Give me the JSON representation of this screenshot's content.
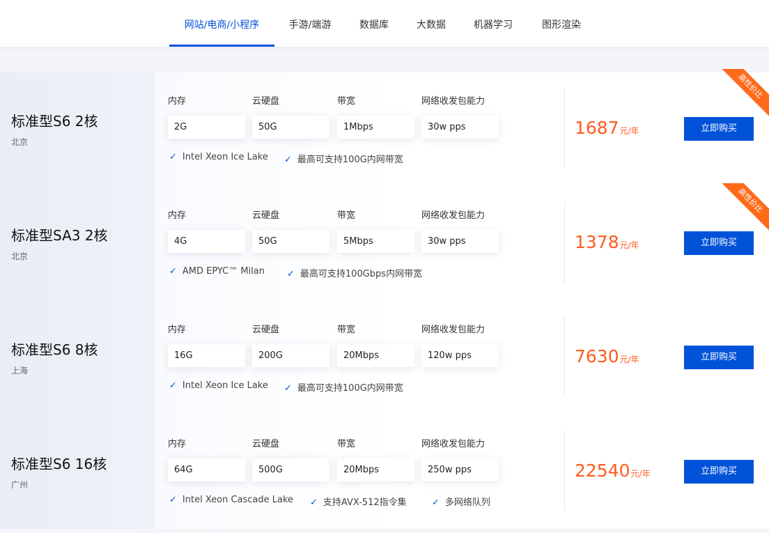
{
  "tabs": [
    {
      "label": "网站/电商/小程序",
      "active": true
    },
    {
      "label": "手游/端游",
      "active": false
    },
    {
      "label": "数据库",
      "active": false
    },
    {
      "label": "大数据",
      "active": false
    },
    {
      "label": "机器学习",
      "active": false
    },
    {
      "label": "图形渲染",
      "active": false
    }
  ],
  "spec_labels": {
    "memory": "内存",
    "disk": "云硬盘",
    "bandwidth": "带宽",
    "pps": "网络收发包能力"
  },
  "buy_label": "立即购买",
  "price_unit": "元/年",
  "ribbon_label": "高性价比",
  "colors": {
    "accent": "#0052d9",
    "price": "#ff5a1f",
    "ribbon": "#ff6a1a"
  },
  "products": [
    {
      "name": "标准型S6 2核",
      "region": "北京",
      "memory": "2G",
      "disk": "50G",
      "bandwidth": "1Mbps",
      "pps": "30w pps",
      "features": [
        "Intel Xeon Ice Lake",
        "最高可支持100G内网带宽"
      ],
      "price": "1687",
      "ribbon": true
    },
    {
      "name": "标准型SA3 2核",
      "region": "北京",
      "memory": "4G",
      "disk": "50G",
      "bandwidth": "5Mbps",
      "pps": "30w pps",
      "features": [
        "AMD EPYC™ Milan",
        "最高可支持100Gbps内网带宽"
      ],
      "price": "1378",
      "ribbon": true
    },
    {
      "name": "标准型S6 8核",
      "region": "上海",
      "memory": "16G",
      "disk": "200G",
      "bandwidth": "20Mbps",
      "pps": "120w pps",
      "features": [
        "Intel Xeon Ice Lake",
        "最高可支持100G内网带宽"
      ],
      "price": "7630",
      "ribbon": false
    },
    {
      "name": "标准型S6 16核",
      "region": "广州",
      "memory": "64G",
      "disk": "500G",
      "bandwidth": "20Mbps",
      "pps": "250w pps",
      "features": [
        "Intel Xeon Cascade Lake",
        "支持AVX-512指令集",
        "多网络队列"
      ],
      "price": "22540",
      "ribbon": false
    }
  ]
}
